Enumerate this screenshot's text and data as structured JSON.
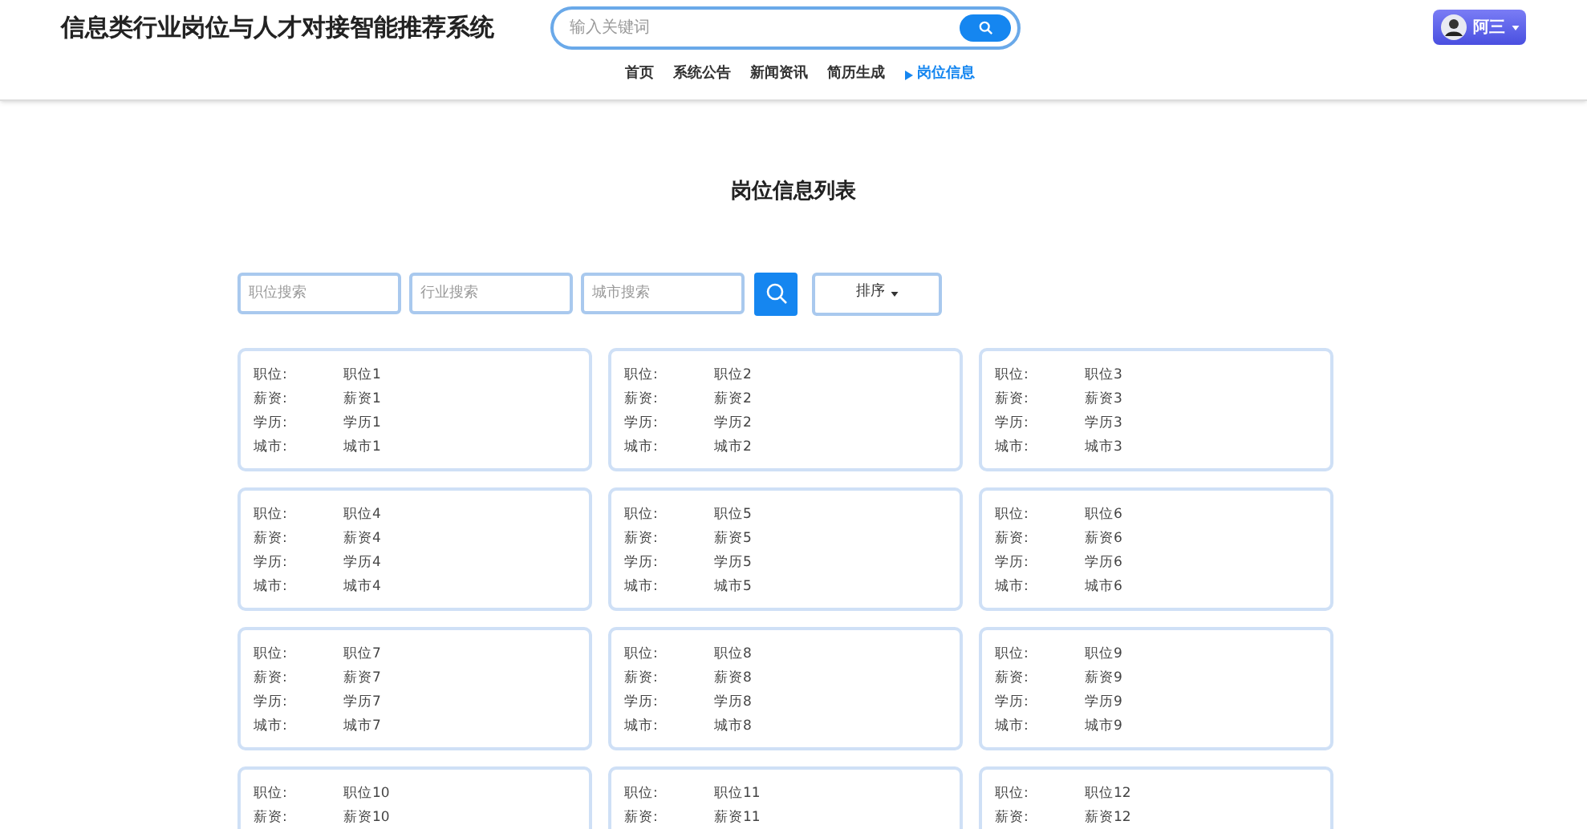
{
  "header": {
    "title": "信息类行业岗位与人才对接智能推荐系统",
    "search": {
      "placeholder": "输入关键词"
    },
    "user": {
      "name": "阿三"
    }
  },
  "nav": [
    {
      "label": "首页",
      "selected": false
    },
    {
      "label": "系统公告",
      "selected": false
    },
    {
      "label": "新闻资讯",
      "selected": false
    },
    {
      "label": "简历生成",
      "selected": false
    },
    {
      "label": "岗位信息",
      "selected": true
    }
  ],
  "page_title": "岗位信息列表",
  "filters": [
    {
      "placeholder": "职位搜索"
    },
    {
      "placeholder": "行业搜索"
    },
    {
      "placeholder": "城市搜索"
    }
  ],
  "sort_button": "排序",
  "jobs": [
    {
      "fields": [
        {
          "label": "职位:",
          "value": "职位1"
        },
        {
          "label": "薪资:",
          "value": "薪资1"
        },
        {
          "label": "学历:",
          "value": "学历1"
        },
        {
          "label": "城市:",
          "value": "城市1"
        }
      ]
    },
    {
      "fields": [
        {
          "label": "职位:",
          "value": "职位2"
        },
        {
          "label": "薪资:",
          "value": "薪资2"
        },
        {
          "label": "学历:",
          "value": "学历2"
        },
        {
          "label": "城市:",
          "value": "城市2"
        }
      ]
    },
    {
      "fields": [
        {
          "label": "职位:",
          "value": "职位3"
        },
        {
          "label": "薪资:",
          "value": "薪资3"
        },
        {
          "label": "学历:",
          "value": "学历3"
        },
        {
          "label": "城市:",
          "value": "城市3"
        }
      ]
    },
    {
      "fields": [
        {
          "label": "职位:",
          "value": "职位4"
        },
        {
          "label": "薪资:",
          "value": "薪资4"
        },
        {
          "label": "学历:",
          "value": "学历4"
        },
        {
          "label": "城市:",
          "value": "城市4"
        }
      ]
    },
    {
      "fields": [
        {
          "label": "职位:",
          "value": "职位5"
        },
        {
          "label": "薪资:",
          "value": "薪资5"
        },
        {
          "label": "学历:",
          "value": "学历5"
        },
        {
          "label": "城市:",
          "value": "城市5"
        }
      ]
    },
    {
      "fields": [
        {
          "label": "职位:",
          "value": "职位6"
        },
        {
          "label": "薪资:",
          "value": "薪资6"
        },
        {
          "label": "学历:",
          "value": "学历6"
        },
        {
          "label": "城市:",
          "value": "城市6"
        }
      ]
    },
    {
      "fields": [
        {
          "label": "职位:",
          "value": "职位7"
        },
        {
          "label": "薪资:",
          "value": "薪资7"
        },
        {
          "label": "学历:",
          "value": "学历7"
        },
        {
          "label": "城市:",
          "value": "城市7"
        }
      ]
    },
    {
      "fields": [
        {
          "label": "职位:",
          "value": "职位8"
        },
        {
          "label": "薪资:",
          "value": "薪资8"
        },
        {
          "label": "学历:",
          "value": "学历8"
        },
        {
          "label": "城市:",
          "value": "城市8"
        }
      ]
    },
    {
      "fields": [
        {
          "label": "职位:",
          "value": "职位9"
        },
        {
          "label": "薪资:",
          "value": "薪资9"
        },
        {
          "label": "学历:",
          "value": "学历9"
        },
        {
          "label": "城市:",
          "value": "城市9"
        }
      ]
    },
    {
      "fields": [
        {
          "label": "职位:",
          "value": "职位10"
        },
        {
          "label": "薪资:",
          "value": "薪资10"
        }
      ]
    },
    {
      "fields": [
        {
          "label": "职位:",
          "value": "职位11"
        },
        {
          "label": "薪资:",
          "value": "薪资11"
        }
      ]
    },
    {
      "fields": [
        {
          "label": "职位:",
          "value": "职位12"
        },
        {
          "label": "薪资:",
          "value": "薪资12"
        }
      ]
    }
  ]
}
